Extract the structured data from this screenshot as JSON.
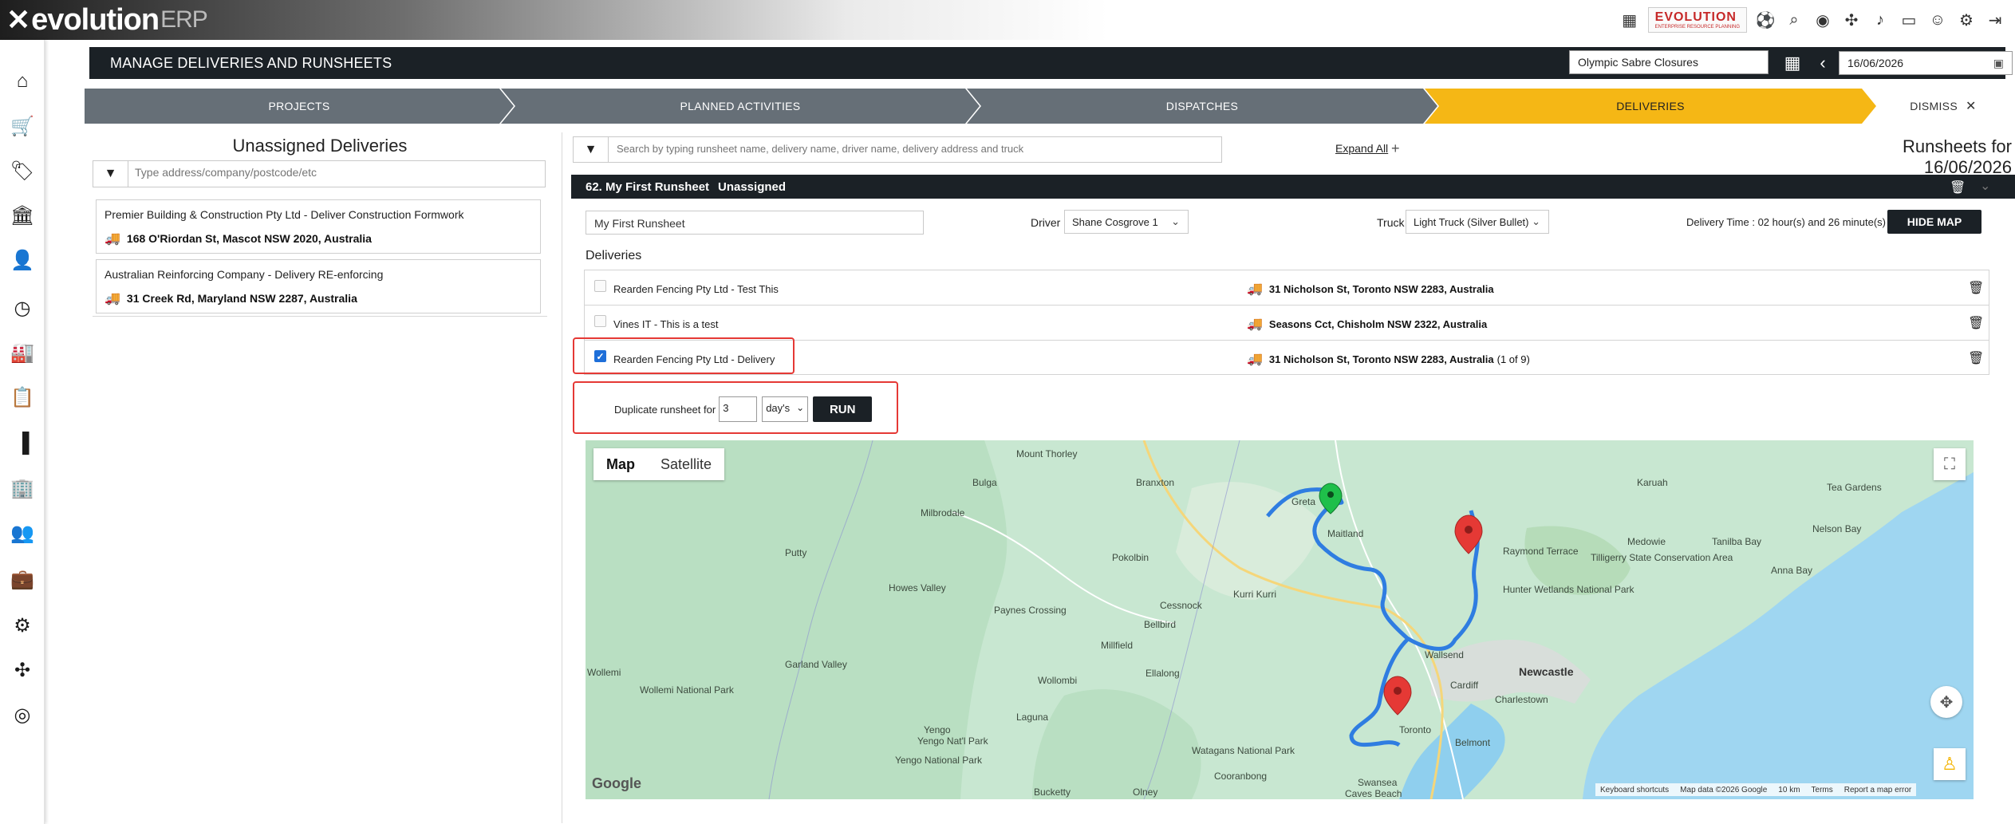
{
  "brand": {
    "name": "evolution",
    "suffix": "ERP"
  },
  "top_logo": {
    "line1": "EVOLUTION",
    "line2": "ENTERPRISE RESOURCE PLANNING"
  },
  "top_icons": [
    "grid-icon",
    "search-icon",
    "support-icon",
    "puzzle-icon",
    "bell-icon",
    "window-icon",
    "user-icon",
    "settings-icon",
    "logout-icon"
  ],
  "sidebar": {
    "items": [
      "home-icon",
      "cart-icon",
      "tag-icon",
      "bank-icon",
      "user-settings-icon",
      "clock-icon",
      "factory-icon",
      "clipboard-icon",
      "chart-icon",
      "building-icon",
      "people-icon",
      "briefcase-icon",
      "gear-icon",
      "puzzle-icon",
      "lifebuoy-icon"
    ]
  },
  "header": {
    "title": "MANAGE DELIVERIES AND RUNSHEETS",
    "location": "Olympic Sabre Closures",
    "date": "16/06/2026"
  },
  "steps": [
    {
      "label": "PROJECTS",
      "state": "done"
    },
    {
      "label": "PLANNED ACTIVITIES",
      "state": "done"
    },
    {
      "label": "DISPATCHES",
      "state": "done"
    },
    {
      "label": "DELIVERIES",
      "state": "active"
    },
    {
      "label": "DISMISS",
      "state": "dismiss"
    }
  ],
  "unassigned": {
    "title": "Unassigned Deliveries",
    "filter_placeholder": "Type address/company/postcode/etc",
    "items": [
      {
        "name": "Premier Building & Construction Pty Ltd - Deliver Construction Formwork",
        "address": "168 O'Riordan St, Mascot NSW 2020, Australia"
      },
      {
        "name": "Australian Reinforcing Company - Delivery RE-enforcing",
        "address": "31 Creek Rd, Maryland NSW 2287, Australia"
      }
    ]
  },
  "runsheets": {
    "search_placeholder": "Search by typing runsheet name, delivery name, driver name, delivery address and truck",
    "expand_all": "Expand All",
    "title": "Runsheets for 16/06/2026",
    "sheet": {
      "number_name": "62. My First Runsheet",
      "status": "Unassigned",
      "name_value": "My First Runsheet",
      "driver_label": "Driver",
      "driver": "Shane Cosgrove 1",
      "truck_label": "Truck",
      "truck": "Light Truck (Silver Bullet)",
      "delivery_time": "Delivery Time : 02 hour(s) and 26 minute(s)",
      "hide_map": "HIDE MAP",
      "deliveries_title": "Deliveries",
      "deliveries": [
        {
          "title": "Rearden Fencing Pty Ltd - Test This",
          "address": "31 Nicholson St, Toronto NSW 2283, Australia",
          "extra": "",
          "checked": false
        },
        {
          "title": "Vines IT - This is a test",
          "address": "Seasons Cct, Chisholm NSW 2322, Australia",
          "extra": "",
          "checked": false
        },
        {
          "title": "Rearden Fencing Pty Ltd - Delivery",
          "address": "31 Nicholson St, Toronto NSW 2283, Australia",
          "extra": "(1 of 9)",
          "checked": true
        }
      ],
      "duplicate": {
        "label": "Duplicate runsheet for",
        "days": "3",
        "unit": "day's",
        "run": "RUN"
      }
    }
  },
  "map": {
    "types": [
      "Map",
      "Satellite"
    ],
    "selected_type": "Map",
    "labels": [
      "Mount Thorley",
      "Branxton",
      "Bulga",
      "Greta",
      "Milbrodale",
      "Maitland",
      "Karuah",
      "Tea Gardens",
      "Medowie",
      "Nelson Bay",
      "Raymond Terrace",
      "Tilligerry State Conservation Area",
      "Tanilba Bay",
      "Anna Bay",
      "Putty",
      "Pokolbin",
      "Kurri Kurri",
      "Cessnock",
      "Howes Valley",
      "Paynes Crossing",
      "Bellbird",
      "Hunter Wetlands National Park",
      "Millfield",
      "Wallsend",
      "Newcastle",
      "Wollemi",
      "Wollemi National Park",
      "Garland Valley",
      "Wollombi",
      "Ellalong",
      "Cardiff",
      "Charlestown",
      "Laguna",
      "Yengo",
      "Yengo Nat'l Park",
      "Yengo National Park",
      "Watagans National Park",
      "Toronto",
      "Belmont",
      "Cooranbong",
      "Swansea",
      "Bucketty",
      "Olney",
      "Caves Beach"
    ],
    "footer": [
      "Keyboard shortcuts",
      "Map data ©2026 Google",
      "10 km",
      "Terms",
      "Report a map error"
    ],
    "google": "Google"
  }
}
